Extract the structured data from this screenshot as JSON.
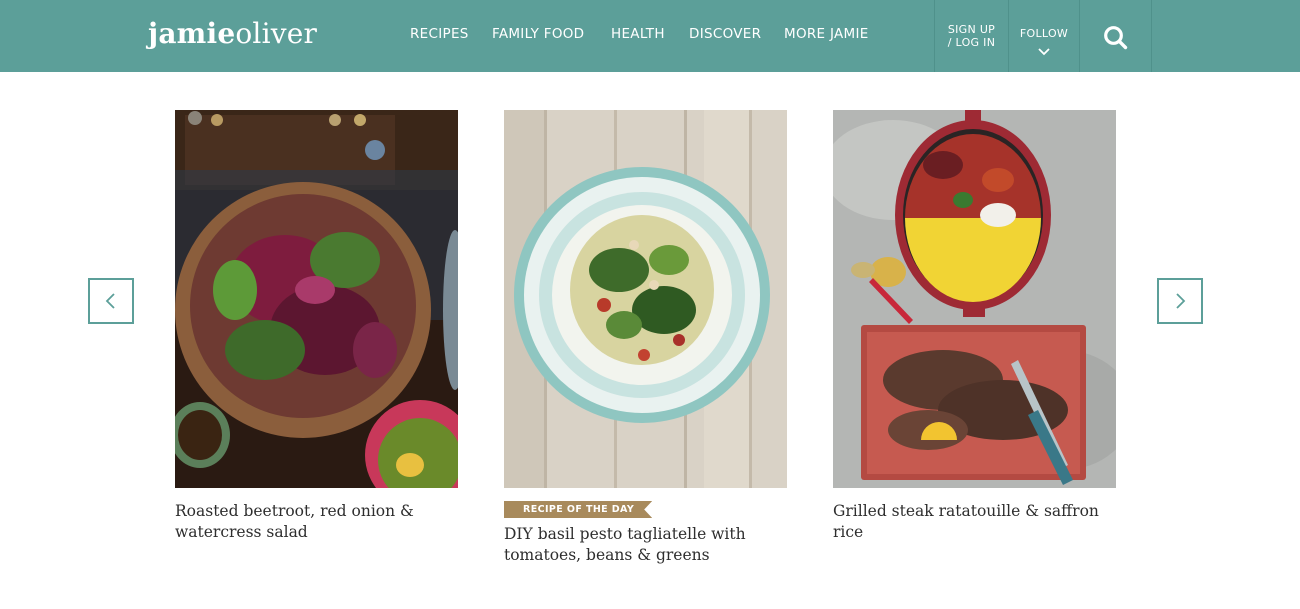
{
  "header": {
    "logo_part1": "jamie",
    "logo_part2": "oliver",
    "nav": [
      "RECIPES",
      "FAMILY FOOD",
      "HEALTH",
      "DISCOVER",
      "MORE JAMIE"
    ],
    "signup_line1": "SIGN UP",
    "signup_line2": "/ LOG IN",
    "follow": "FOLLOW",
    "search_icon": "search-icon",
    "bar_color": "#5c9f99"
  },
  "carousel": {
    "prev_icon": "chevron-left-icon",
    "next_icon": "chevron-right-icon",
    "cards": [
      {
        "title_line1": "Roasted beetroot, red onion &",
        "title_line2": "watercress salad"
      },
      {
        "badge": "RECIPE OF THE DAY",
        "title_line1": "DIY basil pesto tagliatelle with",
        "title_line2": "tomatoes, beans & greens"
      },
      {
        "title_line1": "Grilled steak ratatouille & saffron",
        "title_line2": "rice"
      }
    ],
    "accent_color": "#5c9f99",
    "badge_color": "#a88a5c"
  }
}
